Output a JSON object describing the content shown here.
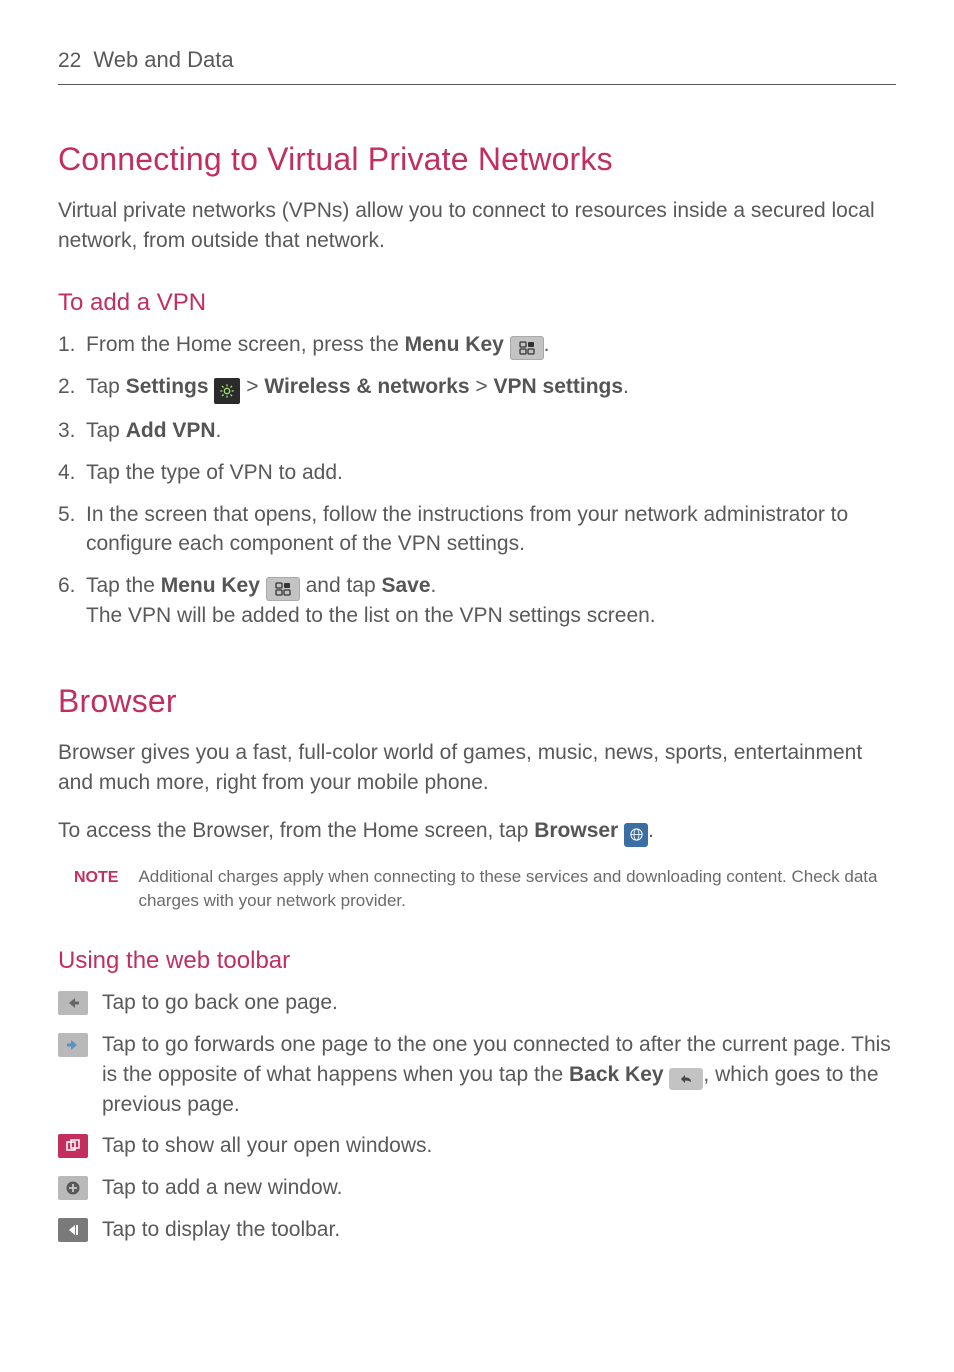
{
  "header": {
    "page": "22",
    "section": "Web and Data"
  },
  "h1_vpn": "Connecting to Virtual Private Networks",
  "vpn_intro": "Virtual private networks (VPNs) allow you to connect to resources inside a secured local network, from outside that network.",
  "h2_addvpn": "To add a VPN",
  "steps": {
    "s1": {
      "n": "1.",
      "a": "From the Home screen, press the ",
      "b": "Menu Key",
      "c": "."
    },
    "s2": {
      "n": "2.",
      "a": "Tap ",
      "b": "Settings",
      "c": " > ",
      "d": "Wireless & networks",
      "e": " > ",
      "f": "VPN settings",
      "g": "."
    },
    "s3": {
      "n": "3.",
      "a": "Tap ",
      "b": "Add VPN",
      "c": "."
    },
    "s4": {
      "n": "4.",
      "a": "Tap the type of VPN to add."
    },
    "s5": {
      "n": "5.",
      "a": "In the screen that opens, follow the instructions from your network administrator to configure each component of the VPN settings."
    },
    "s6": {
      "n": "6.",
      "a": "Tap the ",
      "b": "Menu Key",
      "c": " and tap ",
      "d": "Save",
      "e": ".",
      "f": "The VPN will be added to the list on the VPN settings screen."
    }
  },
  "h1_browser": "Browser",
  "browser_intro": "Browser gives you a fast, full-color world of games, music, news, sports, entertainment and much more, right from your mobile phone.",
  "browser_access": {
    "a": "To access the Browser, from the Home screen, tap ",
    "b": "Browser",
    "c": "."
  },
  "note": {
    "label": "NOTE",
    "text": "Additional charges apply when connecting to these services and downloading content. Check data charges with your network provider."
  },
  "h2_toolbar": "Using the web toolbar",
  "toolbar": {
    "back": "Tap to go back one page.",
    "fwd": {
      "a": "Tap to go forwards one page to the one you connected to after the current page. This is the opposite of what happens when you tap the ",
      "b": "Back Key",
      "c": ", which goes to the previous page."
    },
    "windows": "Tap to show all your open windows.",
    "add": "Tap to add a new window.",
    "display": "Tap to display the toolbar."
  }
}
